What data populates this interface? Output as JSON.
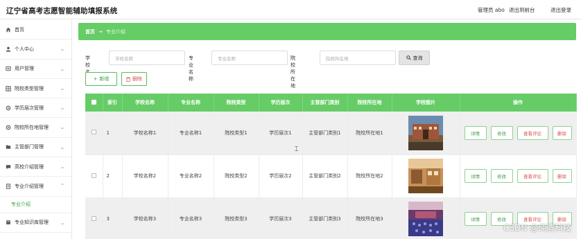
{
  "header": {
    "title": "辽宁省高考志愿智能辅助填报系统",
    "admin": "管理员 abo",
    "to_front": "退出到前台",
    "logout": "退出登录"
  },
  "sidebar": {
    "items": [
      {
        "label": "首页",
        "icon": "home-icon"
      },
      {
        "label": "个人中心",
        "icon": "user-icon"
      },
      {
        "label": "用户管理",
        "icon": "users-icon"
      },
      {
        "label": "院校类型管理",
        "icon": "grid-icon"
      },
      {
        "label": "学历层次管理",
        "icon": "gear-icon"
      },
      {
        "label": "院校所在地管理",
        "icon": "gear-icon"
      },
      {
        "label": "主管部门管理",
        "icon": "folder-icon"
      },
      {
        "label": "高校介绍管理",
        "icon": "chat-icon"
      },
      {
        "label": "专业介绍管理",
        "icon": "document-icon"
      }
    ],
    "sub_item": "专业介绍",
    "last_item": {
      "label": "专业知识库管理",
      "icon": "book-icon"
    }
  },
  "breadcrumb": {
    "home": "首页",
    "sep": "→",
    "current": "专业介绍"
  },
  "search": {
    "school_label": "学校名称",
    "school_placeholder": "学校名称",
    "major_label": "专业名称",
    "major_placeholder": "专业名称",
    "location_label": "院校所在地",
    "location_placeholder": "院校所在地",
    "query_button": "查询"
  },
  "actions": {
    "add": "新增",
    "delete": "删除"
  },
  "table": {
    "headers": [
      "索引",
      "学校名称",
      "专业名称",
      "院校类型",
      "学历层次",
      "主管部门类别",
      "院校所在地",
      "学校图片",
      "操作"
    ],
    "rows": [
      {
        "index": "1",
        "school": "学校名称1",
        "major": "专业名称1",
        "type": "院校类型1",
        "level": "学历层次1",
        "dept": "主管部门类别1",
        "location": "院校所在地1"
      },
      {
        "index": "2",
        "school": "学校名称2",
        "major": "专业名称2",
        "type": "院校类型2",
        "level": "学历层次2",
        "dept": "主管部门类别2",
        "location": "院校所在地2"
      },
      {
        "index": "3",
        "school": "学校名称3",
        "major": "专业名称3",
        "type": "院校类型3",
        "level": "学历层次3",
        "dept": "主管部门类别3",
        "location": "院校所在地3"
      }
    ],
    "ops": {
      "detail": "详情",
      "edit": "修改",
      "comment": "查看评论",
      "remove": "删除"
    }
  },
  "watermark": "CSDN @纯清科技",
  "colors": {
    "accent": "#66cc66",
    "danger": "#d9534f"
  }
}
